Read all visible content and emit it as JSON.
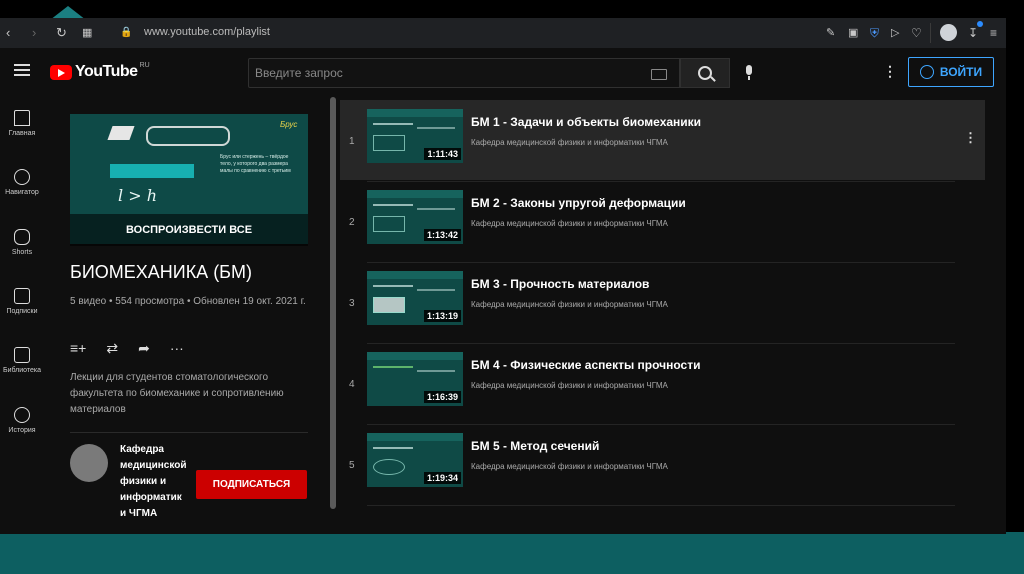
{
  "browser": {
    "url": "www.youtube.com/playlist",
    "icons": [
      "back-icon",
      "forward-icon",
      "reload-icon",
      "grid-icon",
      "lock-icon",
      "edit-icon",
      "camera-icon",
      "shield-icon",
      "send-icon",
      "heart-icon",
      "profile-icon",
      "download-icon",
      "settings-icon"
    ]
  },
  "header": {
    "logo_text": "YouTube",
    "logo_region": "RU",
    "search_placeholder": "Введите запрос",
    "signin_label": "ВОЙТИ",
    "colors": {
      "brand": "#ff0000",
      "accent": "#3ea6ff"
    }
  },
  "sidebar": {
    "items": [
      {
        "label": "Главная",
        "icon": "home-icon"
      },
      {
        "label": "Навигатор",
        "icon": "compass-icon"
      },
      {
        "label": "Shorts",
        "icon": "shorts-icon"
      },
      {
        "label": "Подписки",
        "icon": "subscriptions-icon"
      },
      {
        "label": "Библиотека",
        "icon": "library-icon"
      },
      {
        "label": "История",
        "icon": "history-icon"
      }
    ]
  },
  "playlist": {
    "play_all_label": "ВОСПРОИЗВЕСТИ ВСЕ",
    "thumb_caption": "Брус",
    "thumb_formula": "l > h",
    "thumb_text": "Брус или стержень – твёрдое тело, у которого два размера малы по сравнению с третьим",
    "title": "БИОМЕХАНИКА (БМ)",
    "meta": "5 видео • 554 просмотра • Обновлен 19 окт. 2021 г.",
    "description": "Лекции для студентов стоматологического факультета по биомеханике и сопротивлению материалов",
    "channel_name": "Кафедра медицинской физики и информатик и ЧГМА",
    "subscribe_label": "ПОДПИСАТЬСЯ",
    "subscribe_color": "#cc0000"
  },
  "videos": [
    {
      "index": "1",
      "title": "БМ 1 - Задачи и объекты биомеханики",
      "channel": "Кафедра медицинской физики и информатики ЧГМА",
      "duration": "1:11:43"
    },
    {
      "index": "2",
      "title": "БМ 2 - Законы упругой деформации",
      "channel": "Кафедра медицинской физики и информатики ЧГМА",
      "duration": "1:13:42"
    },
    {
      "index": "3",
      "title": "БМ 3 - Прочность материалов",
      "channel": "Кафедра медицинской физики и информатики ЧГМА",
      "duration": "1:13:19"
    },
    {
      "index": "4",
      "title": "БМ 4 - Физические аспекты прочности",
      "channel": "Кафедра медицинской физики и информатики ЧГМА",
      "duration": "1:16:39"
    },
    {
      "index": "5",
      "title": "БМ 5 - Метод сечений",
      "channel": "Кафедра медицинской физики и информатики ЧГМА",
      "duration": "1:19:34"
    }
  ]
}
